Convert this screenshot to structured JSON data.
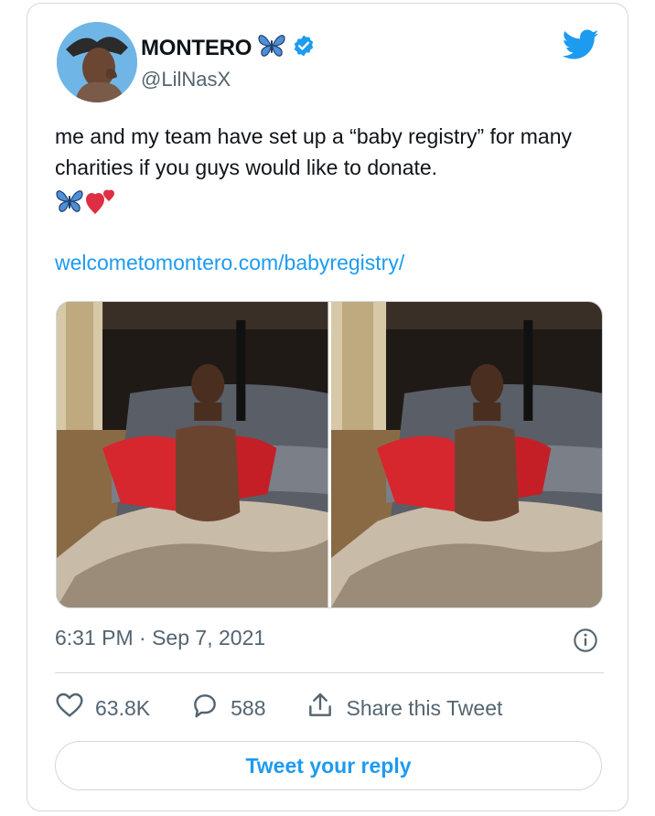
{
  "user": {
    "display_name": "MONTERO",
    "handle": "@LilNasX",
    "verified": true,
    "name_emoji": "butterfly-icon"
  },
  "tweet": {
    "text": "me and my team have set up a “baby registry” for many charities if you guys would like to donate.",
    "emojis": [
      "butterfly-icon",
      "two-hearts-icon"
    ],
    "link": "welcometomontero.com/babyregistry/",
    "timestamp": "6:31 PM · Sep 7, 2021"
  },
  "actions": {
    "likes": "63.8K",
    "replies": "588",
    "share_label": "Share this Tweet"
  },
  "reply_button": "Tweet your reply",
  "colors": {
    "accent": "#1d9bf0",
    "muted": "#536471",
    "border": "#cfd9de",
    "heart": "#e0245e"
  }
}
